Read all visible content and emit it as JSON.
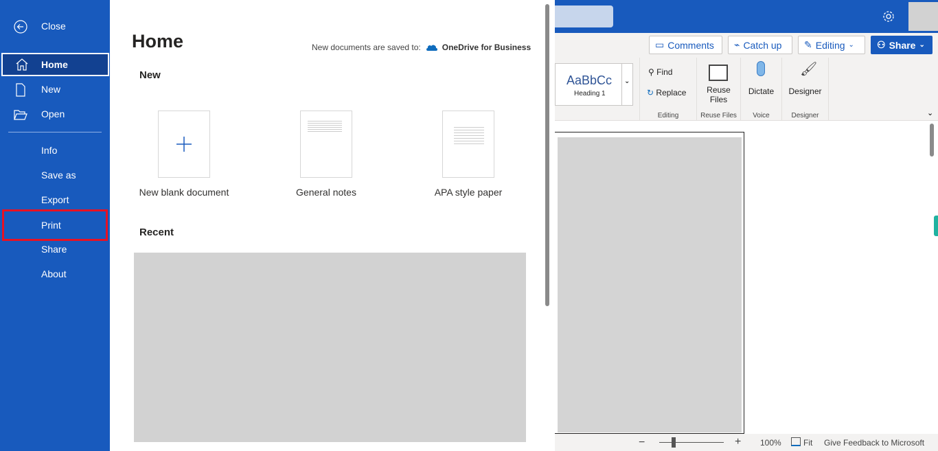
{
  "sidebar": {
    "close": "Close",
    "items": [
      {
        "label": "Home",
        "icon": "home-icon",
        "selected": true
      },
      {
        "label": "New",
        "icon": "document-icon"
      },
      {
        "label": "Open",
        "icon": "folder-open-icon"
      },
      {
        "label": "Info"
      },
      {
        "label": "Save as"
      },
      {
        "label": "Export"
      },
      {
        "label": "Print",
        "highlighted": true
      },
      {
        "label": "Share"
      },
      {
        "label": "About"
      }
    ]
  },
  "panel": {
    "title": "Home",
    "save_note": "New documents are saved to:",
    "save_location": "OneDrive for Business",
    "new_heading": "New",
    "templates": [
      "New blank document",
      "General notes",
      "APA style paper"
    ],
    "recent_heading": "Recent"
  },
  "ribbon": {
    "comments": "Comments",
    "catch_up": "Catch up",
    "editing": "Editing",
    "share": "Share",
    "style_preview": "AaBbCc",
    "style_name": "Heading 1",
    "find": "Find",
    "replace": "Replace",
    "editing_group": "Editing",
    "reuse_files": "Reuse Files",
    "reuse_group": "Reuse Files",
    "dictate": "Dictate",
    "voice_group": "Voice",
    "designer": "Designer",
    "designer_group": "Designer"
  },
  "status": {
    "zoom": "100%",
    "fit": "Fit",
    "feedback": "Give Feedback to Microsoft"
  },
  "colors": {
    "brand": "#185abd",
    "highlight": "#e81123"
  }
}
